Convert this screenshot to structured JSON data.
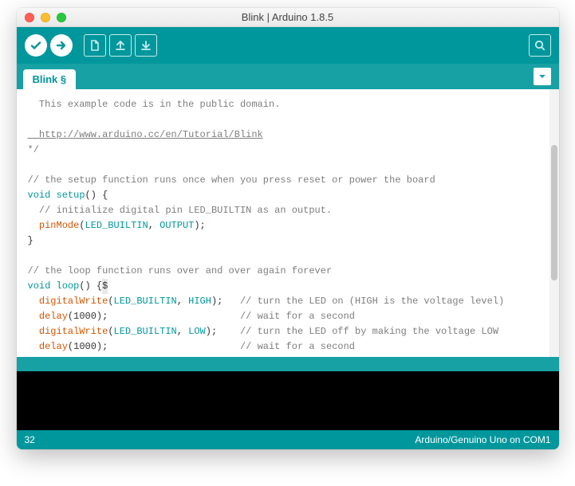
{
  "window": {
    "title": "Blink | Arduino 1.8.5"
  },
  "tab": {
    "label": "Blink §"
  },
  "code": {
    "line1": "  This example code is in the public domain.",
    "blank1": "",
    "link": "  http://www.arduino.cc/en/Tutorial/Blink",
    "endcomment": "*/",
    "blank2": "",
    "c_setup": "// the setup function runs once when you press reset or power the board",
    "kw_void1": "void",
    "fn_setup": " setup",
    "setup_sig": "() {",
    "c_init": "  // initialize digital pin LED_BUILTIN as an output.",
    "fn_pinmode": "  pinMode",
    "pinmode_open": "(",
    "const_ledb1": "LED_BUILTIN",
    "comma1": ", ",
    "const_output": "OUTPUT",
    "close1": ");",
    "brace1": "}",
    "blank3": "",
    "c_loop": "// the loop function runs over and over again forever",
    "kw_void2": "void",
    "fn_loop": " loop",
    "loop_sig": "() {",
    "cursor_char": "$",
    "fn_dw1": "  digitalWrite",
    "dw1_open": "(",
    "const_ledb2": "LED_BUILTIN",
    "comma2": ", ",
    "const_high": "HIGH",
    "dw1_close": ");   ",
    "c_dw1": "// turn the LED on (HIGH is the voltage level)",
    "fn_delay1": "  delay",
    "delay1_args": "(1000);                       ",
    "c_delay1": "// wait for a second",
    "fn_dw2": "  digitalWrite",
    "dw2_open": "(",
    "const_ledb3": "LED_BUILTIN",
    "comma3": ", ",
    "const_low": "LOW",
    "dw2_close": ");    ",
    "c_dw2": "// turn the LED off by making the voltage LOW",
    "fn_delay2": "  delay",
    "delay2_args": "(1000);                       ",
    "c_delay2": "// wait for a second",
    "brace2": "}"
  },
  "footer": {
    "line": "32",
    "board": "Arduino/Genuino Uno on COM1"
  }
}
